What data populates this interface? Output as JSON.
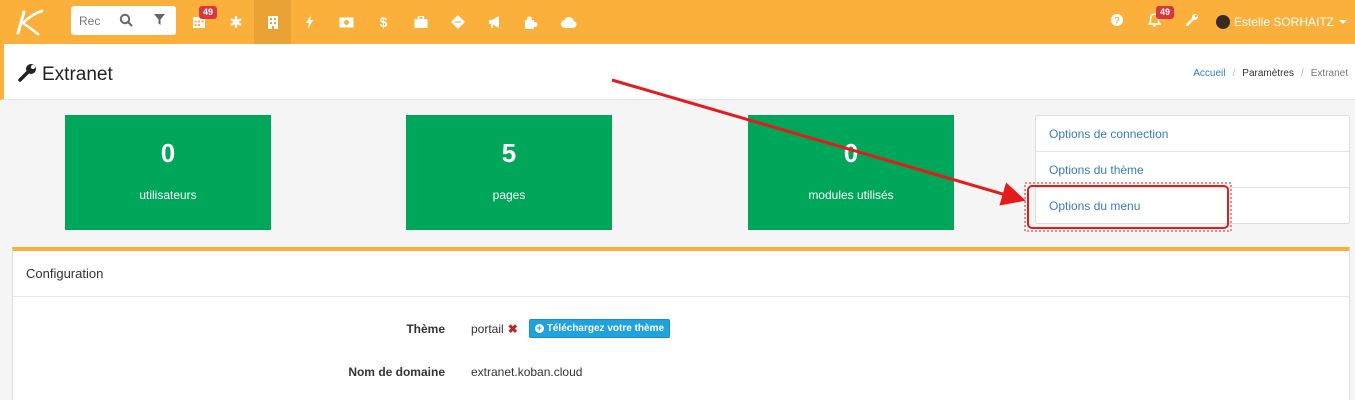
{
  "topbar": {
    "search_placeholder": "Rec",
    "calendar_badge": "49",
    "notifications_badge": "49",
    "user_name": "Estelle SORHAITZ",
    "nav_icons": [
      "calendar-icon",
      "asterisk-icon",
      "building-icon",
      "bolt-icon",
      "money-icon",
      "dollar-icon",
      "briefcase-icon",
      "ticket-icon",
      "megaphone-icon",
      "puzzle-icon",
      "cloud-icon"
    ]
  },
  "page": {
    "title": "Extranet",
    "breadcrumb": [
      "Accueil",
      "Paramètres",
      "Extranet"
    ]
  },
  "tiles": [
    {
      "value": "0",
      "label": "utilisateurs"
    },
    {
      "value": "5",
      "label": "pages"
    },
    {
      "value": "0",
      "label": "modules utilisés"
    }
  ],
  "options": [
    "Options de connection",
    "Options du thème",
    "Options du menu"
  ],
  "config": {
    "title": "Configuration",
    "theme_label": "Thème",
    "theme_value": "portail",
    "upload_button": "Téléchargez votre thème",
    "domain_label": "Nom de domaine",
    "domain_value": "extranet.koban.cloud"
  },
  "colors": {
    "topbar": "#fbb03b",
    "tile": "#00a65a",
    "link": "#3a7bbf",
    "annotation": "#e51b1b"
  }
}
